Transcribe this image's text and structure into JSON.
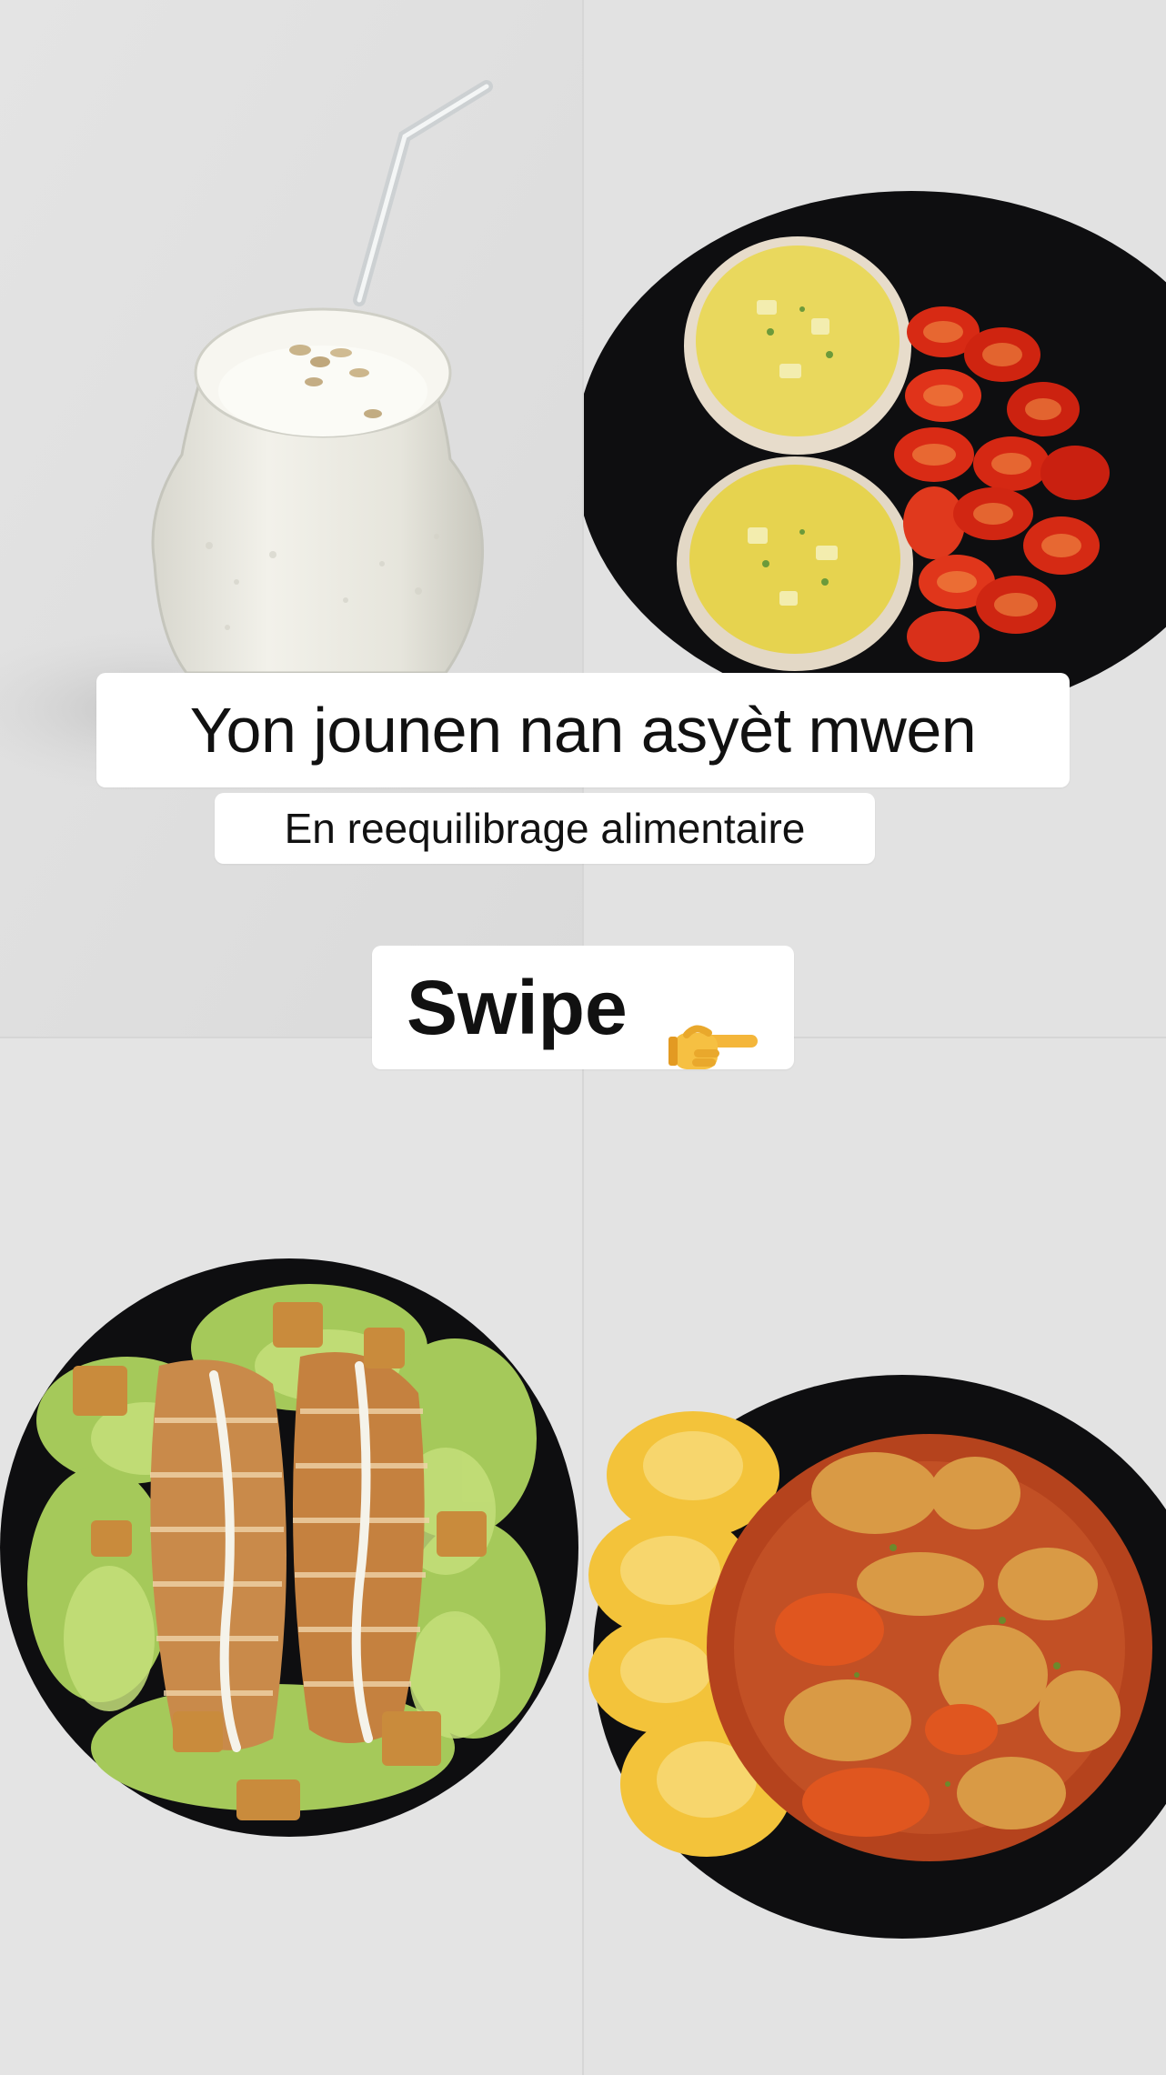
{
  "captions": {
    "title": "Yon jounen nan asyèt mwen",
    "subtitle": "En reequilibrage alimentaire",
    "swipe": "Swipe"
  },
  "icons": {
    "swipe_hand": "pointing-right-hand-icon"
  },
  "colors": {
    "background": "#e9e9e9",
    "caption_bg": "#ffffff",
    "caption_text": "#111111",
    "plate": "#0e0e10"
  }
}
